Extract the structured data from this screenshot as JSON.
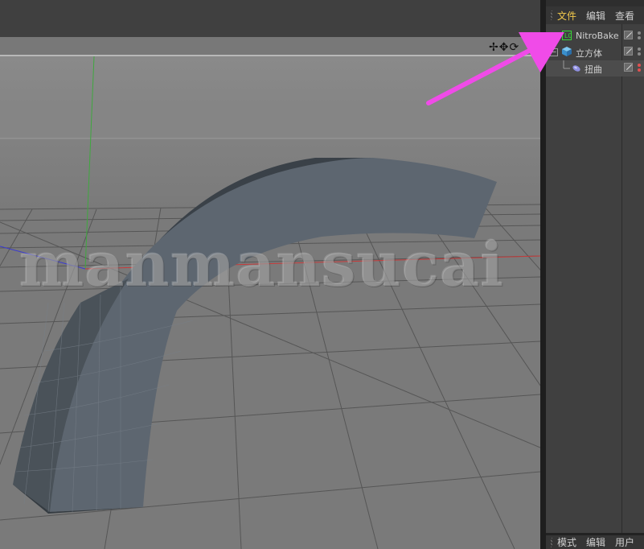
{
  "object_manager": {
    "menu": [
      "文件",
      "编辑",
      "查看"
    ],
    "tree": [
      {
        "label": "NitroBake",
        "icon": "nitrobake-tag-icon",
        "expander": "",
        "selected": false,
        "dot_color": "#8a8a8a"
      },
      {
        "label": "立方体",
        "icon": "cube-object-icon",
        "expander": "−",
        "selected": false,
        "dot_color": "#8a8a8a"
      },
      {
        "label": "扭曲",
        "icon": "twist-deformer-icon",
        "expander": "",
        "selected": true,
        "dot_color": "#e05050"
      }
    ]
  },
  "attribute_manager": {
    "menu": [
      "模式",
      "编辑",
      "用户"
    ]
  },
  "viewport": {
    "tool_icons": "✢✥⟳"
  },
  "watermark": "manmansucai",
  "colors": {
    "menu_active": "#f2c94c",
    "annotation_arrow": "#f04be8",
    "viewport_bg": "#7c7c7c",
    "object_surface": "#5d6670"
  }
}
